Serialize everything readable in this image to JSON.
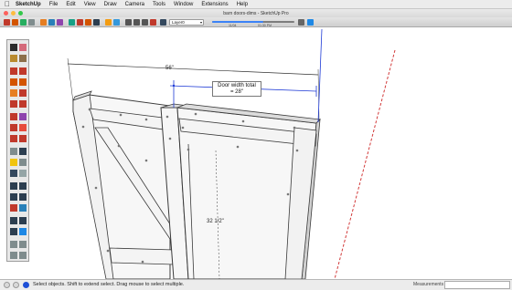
{
  "menubar": {
    "apple": "",
    "app_name": "SketchUp",
    "items": [
      "File",
      "Edit",
      "View",
      "Draw",
      "Camera",
      "Tools",
      "Window",
      "Extensions",
      "Help"
    ]
  },
  "window": {
    "title": "barn doors-dims - SketchUp Pro"
  },
  "toolbar": {
    "layer_value": "Layer0",
    "time_left": "11/04",
    "time_right": "01:30 PM",
    "time_progress": 0.62
  },
  "viewport": {
    "dim_width": "56\"",
    "dim_height": "32 1/2\"",
    "tooltip_line1": "Door width total",
    "tooltip_line2": "= 28\""
  },
  "statusbar": {
    "text": "Select objects. Shift to extend select. Drag mouse to select multiple.",
    "measurements_label": "Measurements",
    "measurements_value": ""
  },
  "colors": {
    "accent_blue": "#1e3ad6",
    "axis_red": "#d23a3a",
    "door_face": "#f7f7f7",
    "door_edge": "#3a3a3a"
  }
}
